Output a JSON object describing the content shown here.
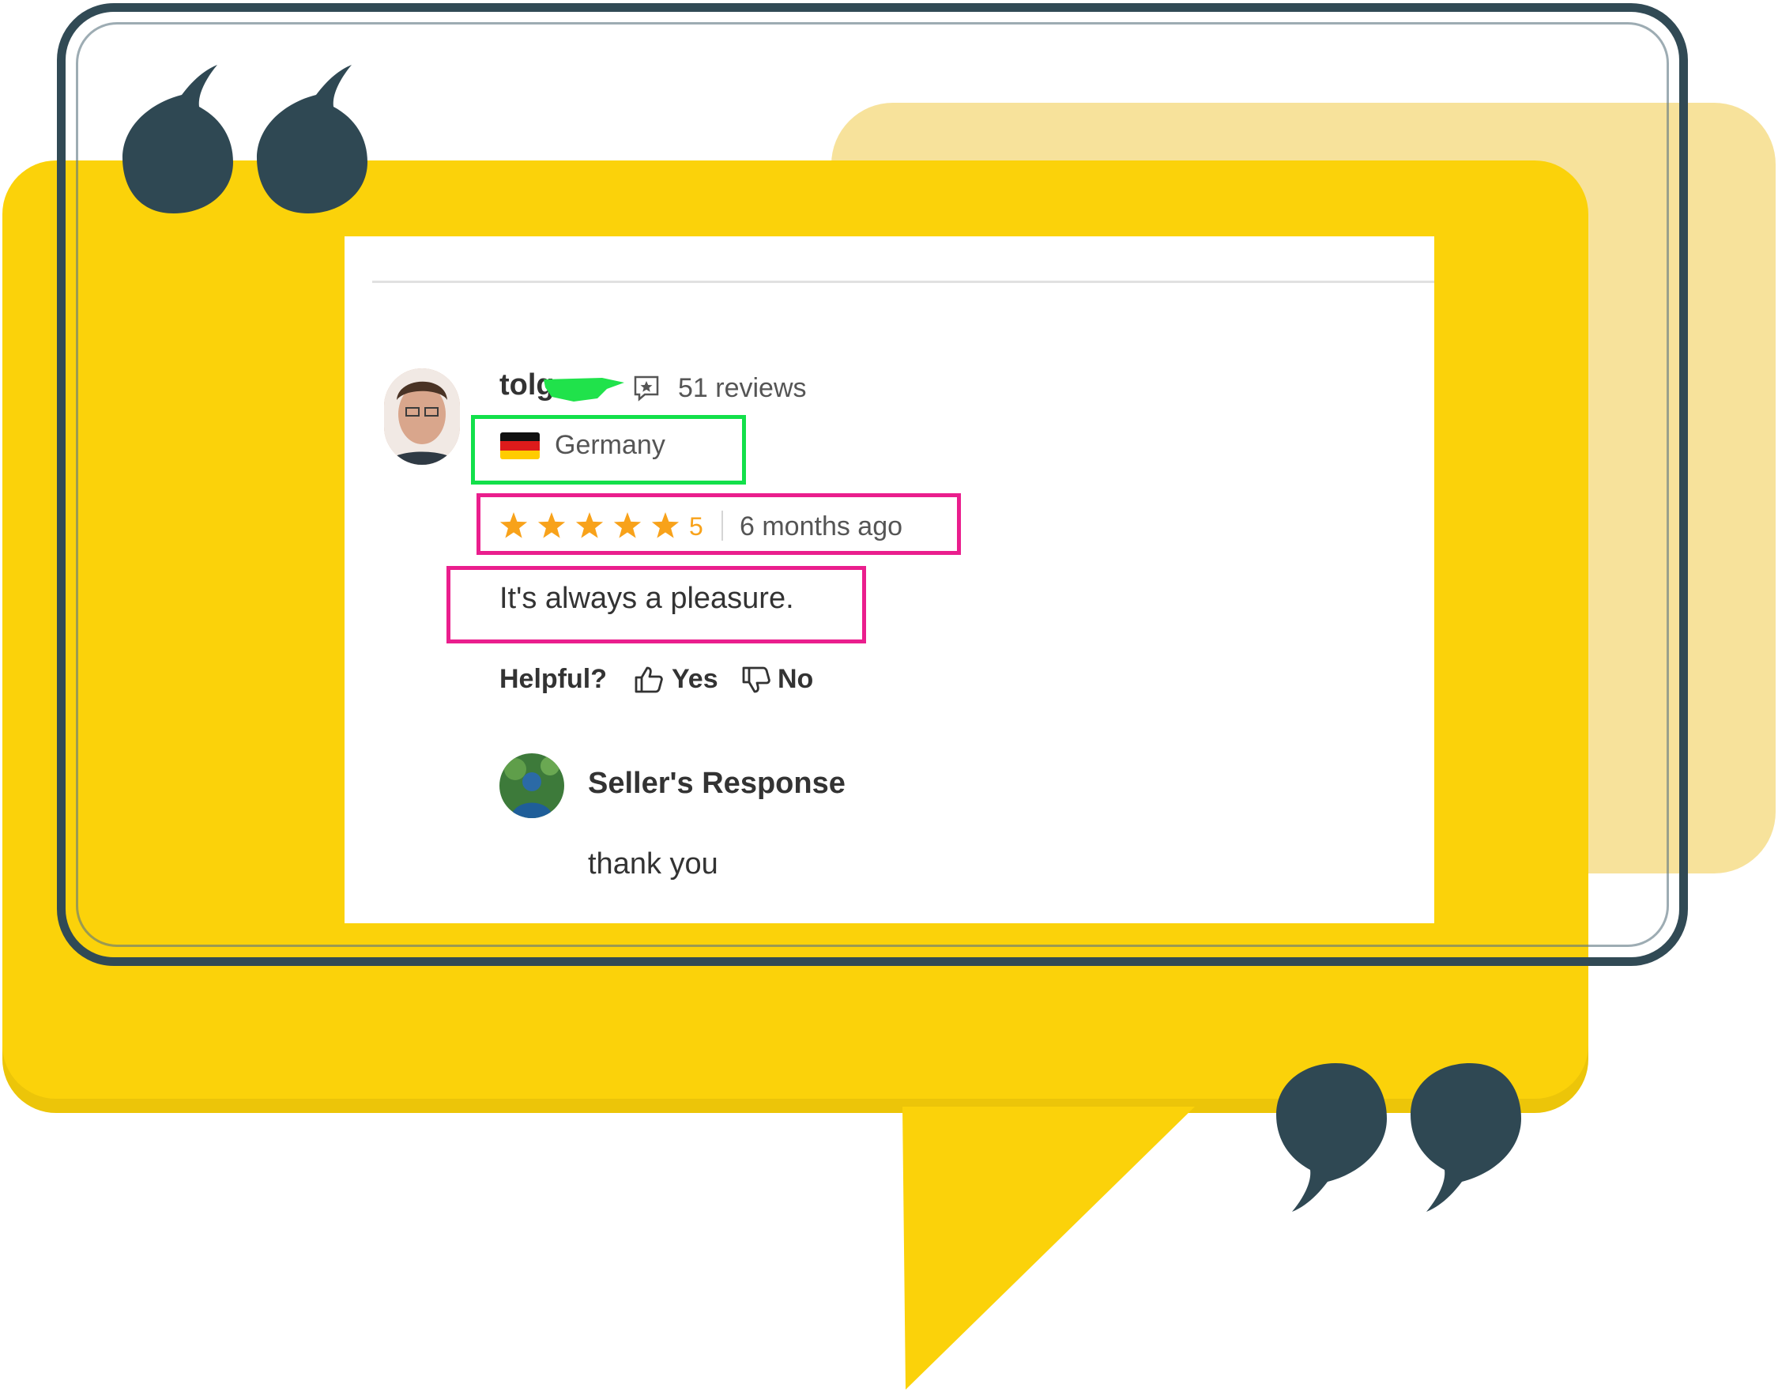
{
  "colors": {
    "accent_yellow": "#fbd20a",
    "back_card": "#f7e29b",
    "frame": "#314a55",
    "highlight_green": "#12e04a",
    "highlight_pink": "#ea1e8d",
    "star": "#f8a21a"
  },
  "review": {
    "username": "tolg",
    "reviews_count": "51 reviews",
    "country": "Germany",
    "rating": 5,
    "rating_label": "5",
    "age": "6 months ago",
    "text": "It's always a pleasure.",
    "helpful_label": "Helpful?",
    "yes_label": "Yes",
    "no_label": "No"
  },
  "seller": {
    "title": "Seller's Response",
    "reply": "thank you"
  },
  "icons": {
    "open_quote": "quote-open-icon",
    "close_quote": "quote-close-icon",
    "reviews": "review-badge-icon",
    "thumbs_up": "thumbs-up-icon",
    "thumbs_down": "thumbs-down-icon",
    "flag": "germany-flag-icon",
    "star": "star-icon"
  }
}
